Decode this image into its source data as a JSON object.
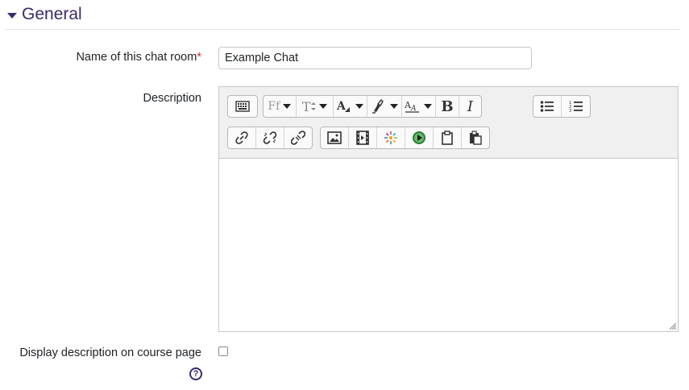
{
  "section": {
    "title": "General"
  },
  "name_field": {
    "label": "Name of this chat room",
    "required_mark": "*",
    "value": "Example Chat"
  },
  "description": {
    "label": "Description",
    "toolbar": {
      "font_family_label": "Ff",
      "font_size_label": "T",
      "bold_label": "B",
      "italic_label": "I"
    }
  },
  "display_description": {
    "label": "Display description on course page",
    "checked": false
  },
  "help_icon": {
    "label": "?"
  },
  "colors": {
    "accent": "#3b2a6b",
    "required": "#c62828"
  }
}
